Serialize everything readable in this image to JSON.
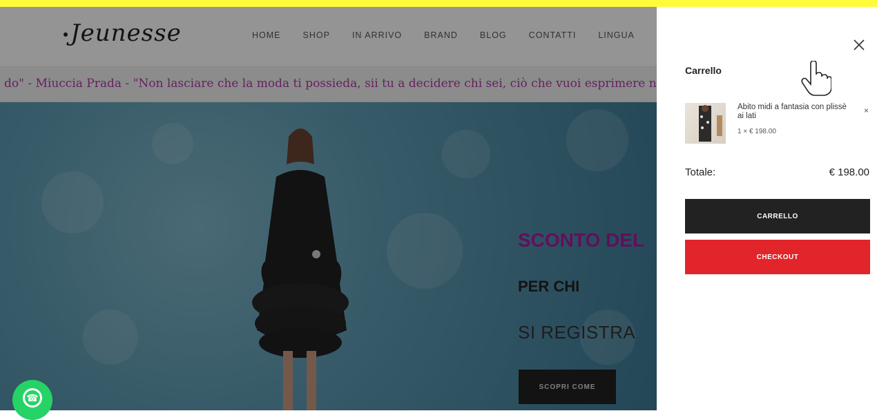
{
  "header": {
    "logo_text": "Jeunesse",
    "nav": [
      "HOME",
      "SHOP",
      "IN ARRIVO",
      "BRAND",
      "BLOG",
      "CONTATTI",
      "LINGUA"
    ]
  },
  "ticker": {
    "text": "do\" - Miuccia Prada - \"Non lasciare che la moda ti possieda, sii tu a decidere chi sei, ciò che vuoi esprimere nel modo i"
  },
  "hero": {
    "title": "SCONTO DEL",
    "subtitle": "PER CHI",
    "subtitle2": "SI REGISTRA",
    "button_label": "SCOPRI COME"
  },
  "cart": {
    "title": "Carrello",
    "item": {
      "name": "Abito midi a fantasia con plissè ai lati",
      "qty_price": "1 × € 198.00",
      "remove_label": "×"
    },
    "total_label": "Totale:",
    "total_value": "€ 198.00",
    "cart_button": "CARRELLO",
    "checkout_button": "CHECKOUT"
  },
  "colors": {
    "accent_yellow": "#fffb3a",
    "ticker_text": "#b039a6",
    "hero_title": "#a51da0",
    "checkout_red": "#e1252a",
    "dark_button": "#222222",
    "whatsapp_green": "#25d366"
  },
  "icons": {
    "close": "close-icon",
    "whatsapp": "whatsapp-icon",
    "cursor": "hand-pointer-icon"
  }
}
